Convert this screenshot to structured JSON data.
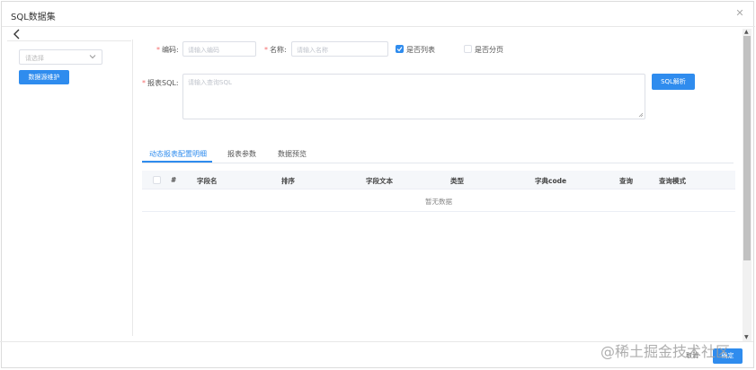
{
  "dialog": {
    "title": "SQL数据集",
    "close_icon": "close-icon",
    "back_icon": "chevron-left-icon"
  },
  "left_panel": {
    "select_placeholder": "请选择",
    "maintain_button": "数据源维护"
  },
  "form": {
    "code": {
      "label": "编码:",
      "placeholder": "请输入编码",
      "value": ""
    },
    "name": {
      "label": "名称:",
      "placeholder": "请输入名称",
      "value": ""
    },
    "is_list": {
      "label": "是否列表",
      "checked": true
    },
    "is_paged": {
      "label": "是否分页",
      "checked": false
    },
    "sql": {
      "label": "报表SQL:",
      "placeholder": "请输入查询SQL",
      "value": ""
    },
    "parse_button": "SQL解析"
  },
  "tabs": [
    {
      "label": "动态报表配置明细",
      "active": true
    },
    {
      "label": "报表参数",
      "active": false
    },
    {
      "label": "数据预览",
      "active": false
    }
  ],
  "table": {
    "columns": [
      "#",
      "字段名",
      "排序",
      "字段文本",
      "类型",
      "字典code",
      "查询",
      "查询模式"
    ],
    "empty_text": "暂无数据"
  },
  "footer": {
    "cancel_button": "取消",
    "confirm_button": "确定"
  },
  "watermark": "@稀土掘金技术社区",
  "colors": {
    "primary": "#2f8cee",
    "required": "#f56c6c",
    "border": "#dcdfe6"
  }
}
